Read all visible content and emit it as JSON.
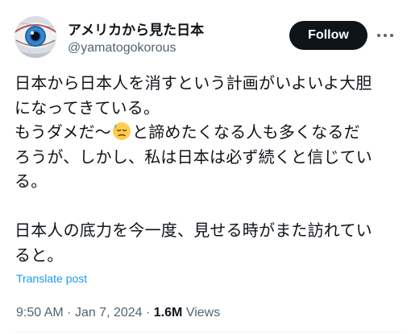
{
  "author": {
    "display_name": "アメリカから見た日本",
    "handle": "@yamatogokorous",
    "avatar_icon": "eye-avatar-icon"
  },
  "actions": {
    "follow_label": "Follow",
    "more_icon": "more-horizontal-icon"
  },
  "post": {
    "lines": [
      "日本から日本人を消すという計画がいよいよ大胆",
      "になってきている。",
      "もうダメだ〜",
      "と諦めたくなる人も多くなるだ",
      "ろうが、しかし、私は日本は必ず続くと信じてい",
      "る。",
      "日本人の底力を今一度、見せる時がまた訪れてい",
      "ると。"
    ],
    "emoji": "downcast-face-with-sweat-icon"
  },
  "translate_label": "Translate post",
  "meta": {
    "time": "9:50 AM",
    "separator": "·",
    "date": "Jan 7, 2024",
    "views_count": "1.6M",
    "views_label": "Views"
  },
  "colors": {
    "text": "#0f1419",
    "secondary": "#536471",
    "link": "#1d9bf0",
    "follow_bg": "#0f1419"
  }
}
